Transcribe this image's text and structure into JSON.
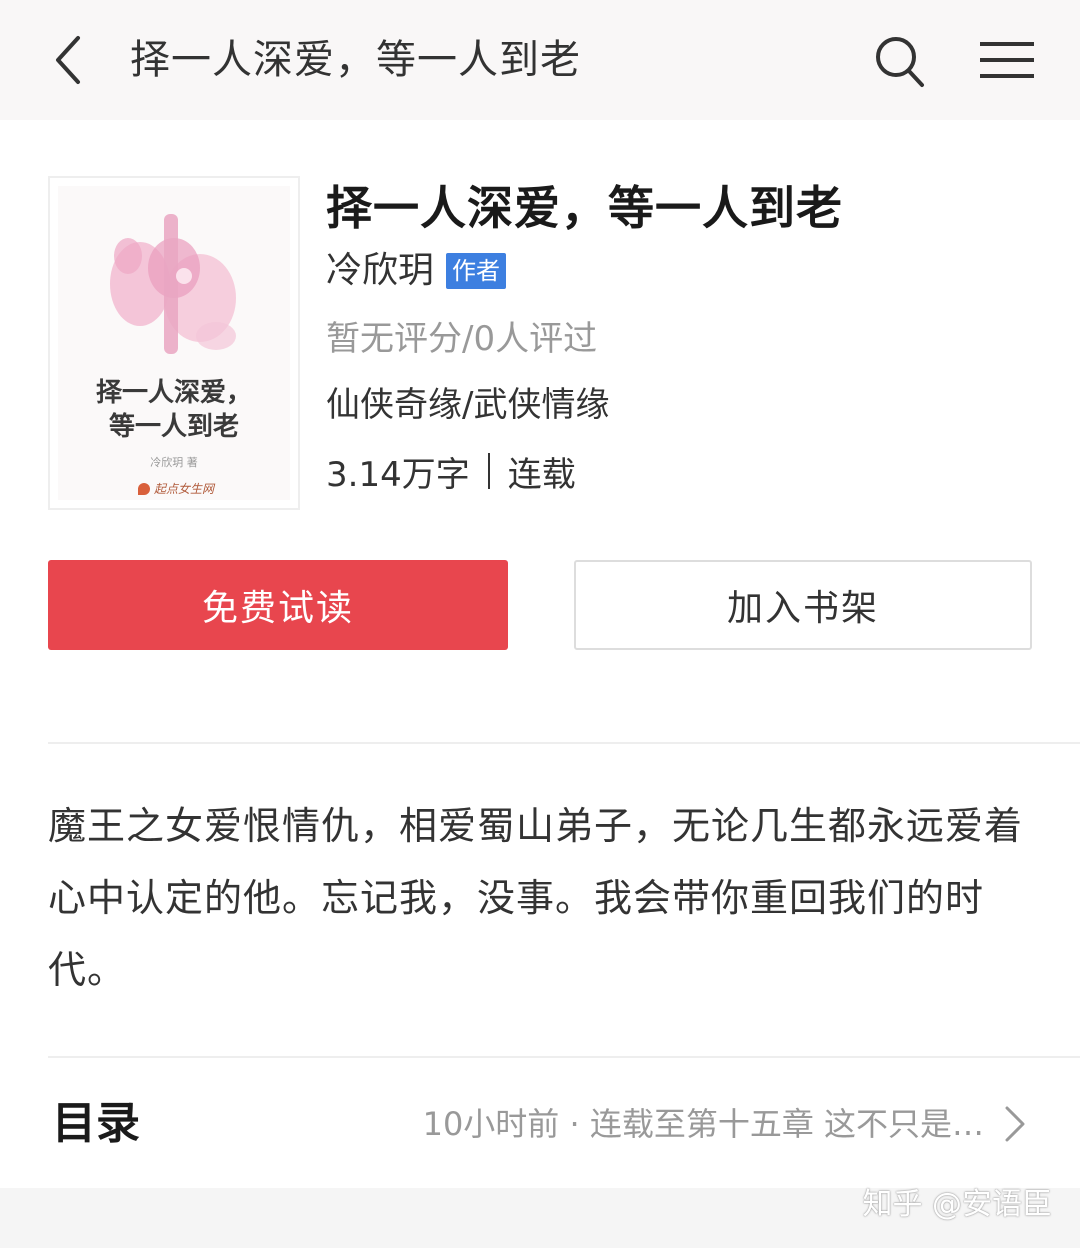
{
  "nav": {
    "title": "择一人深爱，等一人到老",
    "back_icon": "chevron-left-icon",
    "search_icon": "search-icon",
    "menu_icon": "menu-icon"
  },
  "book": {
    "cover": {
      "title_line1": "择一人深爱，",
      "title_line2": "等一人到老",
      "author": "冷欣玥 著",
      "publisher": "起点女生网"
    },
    "title": "择一人深爱，等一人到老",
    "author": "冷欣玥",
    "author_badge": "作者",
    "rating": "暂无评分/0人评过",
    "category": "仙侠奇缘/武侠情缘",
    "word_count": "3.14万字",
    "status": "连载"
  },
  "actions": {
    "read_label": "免费试读",
    "shelf_label": "加入书架"
  },
  "intro": {
    "text": "魔王之女爱恨情仇，相爱蜀山弟子，无论几生都永远爱着心中认定的他。忘记我，没事。我会带你重回我们的时代。"
  },
  "catalog": {
    "heading": "目录",
    "update": "10小时前 · 连载至第十五章 这不只是…"
  },
  "watermark": "知乎 @安语臣",
  "colors": {
    "accent_red": "#e8464e",
    "badge_blue": "#3d7fe0",
    "muted_text": "#999999"
  }
}
